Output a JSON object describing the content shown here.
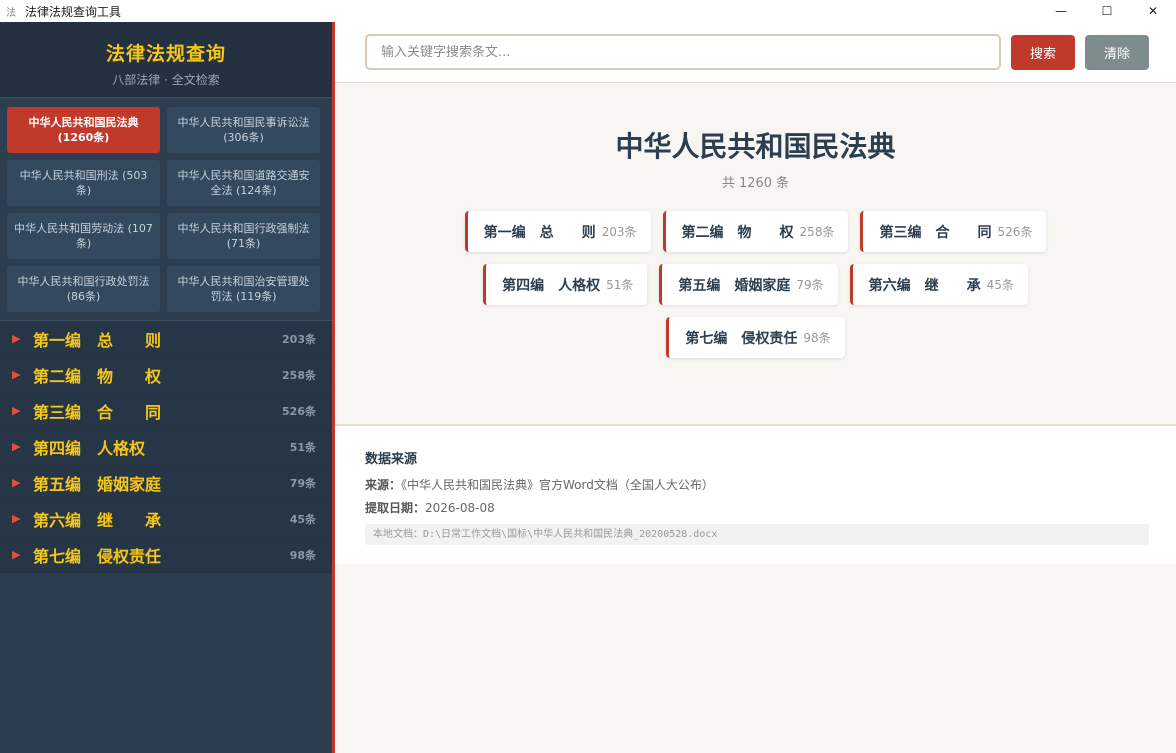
{
  "window": {
    "title": "法律法规查询工具",
    "icon": "法",
    "minimize": "—",
    "maximize": "☐",
    "close": "✕"
  },
  "sidebar": {
    "title": "法律法规查询",
    "subtitle": "八部法律 · 全文检索",
    "laws": [
      {
        "label": "中华人民共和国民法典 (1260条)",
        "active": true
      },
      {
        "label": "中华人民共和国民事诉讼法 (306条)",
        "active": false
      },
      {
        "label": "中华人民共和国刑法 (503条)",
        "active": false
      },
      {
        "label": "中华人民共和国道路交通安全法 (124条)",
        "active": false
      },
      {
        "label": "中华人民共和国劳动法 (107条)",
        "active": false
      },
      {
        "label": "中华人民共和国行政强制法 (71条)",
        "active": false
      },
      {
        "label": "中华人民共和国行政处罚法 (86条)",
        "active": false
      },
      {
        "label": "中华人民共和国治安管理处罚法 (119条)",
        "active": false
      }
    ],
    "chapters": [
      {
        "name": "第一编　总　　则",
        "count": "203条"
      },
      {
        "name": "第二编　物　　权",
        "count": "258条"
      },
      {
        "name": "第三编　合　　同",
        "count": "526条"
      },
      {
        "name": "第四编　人格权",
        "count": "51条"
      },
      {
        "name": "第五编　婚姻家庭",
        "count": "79条"
      },
      {
        "name": "第六编　继　　承",
        "count": "45条"
      },
      {
        "name": "第七编　侵权责任",
        "count": "98条"
      }
    ]
  },
  "search": {
    "placeholder": "输入关键字搜索条文...",
    "search_label": "搜索",
    "clear_label": "清除"
  },
  "main": {
    "law_title": "中华人民共和国民法典",
    "law_count": "共 1260 条",
    "parts": [
      {
        "name": "第一编　总　　则",
        "count": "203条"
      },
      {
        "name": "第二编　物　　权",
        "count": "258条"
      },
      {
        "name": "第三编　合　　同",
        "count": "526条"
      },
      {
        "name": "第四编　人格权",
        "count": "51条"
      },
      {
        "name": "第五编　婚姻家庭",
        "count": "79条"
      },
      {
        "name": "第六编　继　　承",
        "count": "45条"
      },
      {
        "name": "第七编　侵权责任",
        "count": "98条"
      }
    ]
  },
  "source": {
    "heading": "数据来源",
    "source_label": "来源：",
    "source_value": "《中华人民共和国民法典》官方Word文档（全国人大公布）",
    "date_label": "提取日期：",
    "date_value": "2026-08-08",
    "local_path": "本地文档：D:\\日常工作文档\\国标\\中华人民共和国民法典_20200528.docx"
  },
  "colors": {
    "accent": "#c0392b",
    "sidebar_bg": "#2c3e50",
    "gold": "#f5c518"
  }
}
